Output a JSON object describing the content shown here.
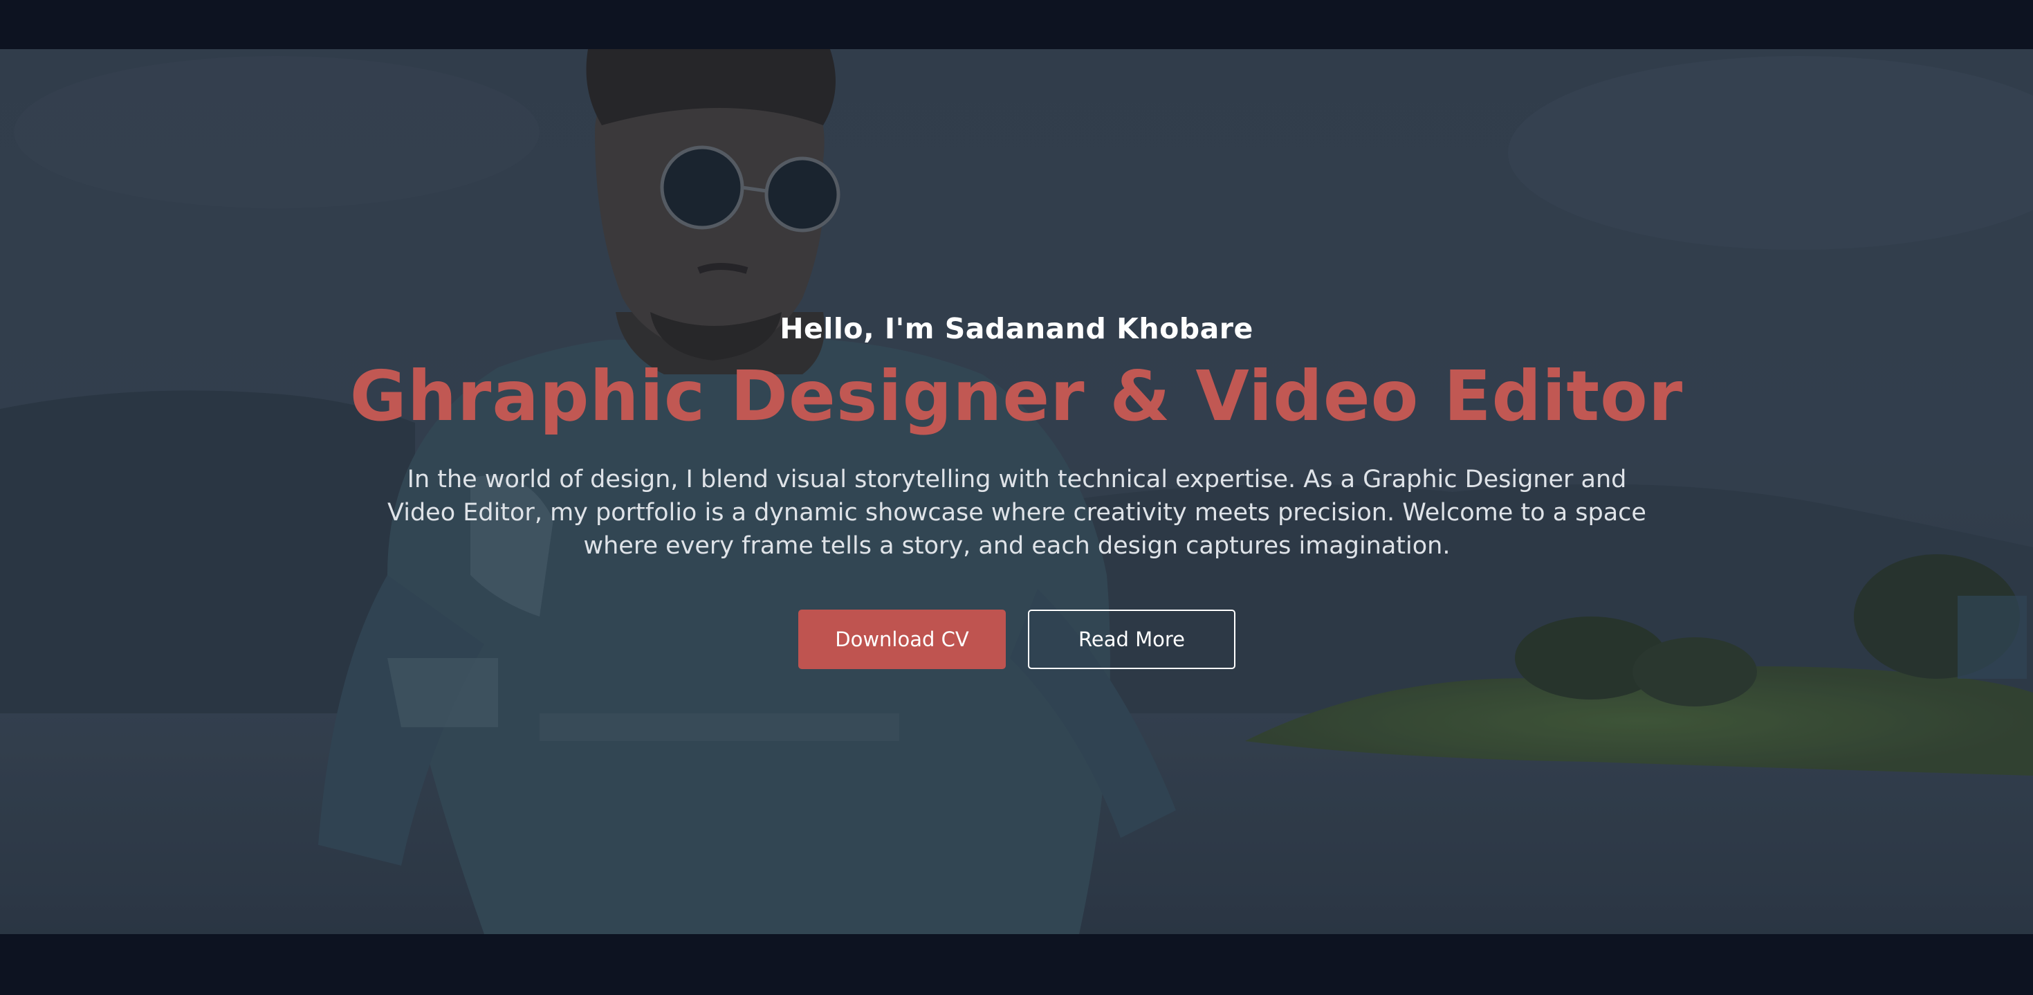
{
  "hero": {
    "greeting": "Hello, I'm Sadanand Khobare",
    "headline": "Ghraphic Designer & Video Editor",
    "intro": "In the world of design, I blend visual storytelling with technical expertise. As a Graphic Designer and Video Editor, my portfolio is a dynamic showcase where creativity meets precision. Welcome to a space where every frame tells a story, and each design captures imagination.",
    "buttons": {
      "download_label": "Download CV",
      "read_more_label": "Read More"
    }
  },
  "colors": {
    "background": "#0d1321",
    "accent": "#c15853",
    "button_primary": "#bf5450",
    "text_primary": "#ffffff",
    "text_body": "#dfe3e8"
  }
}
